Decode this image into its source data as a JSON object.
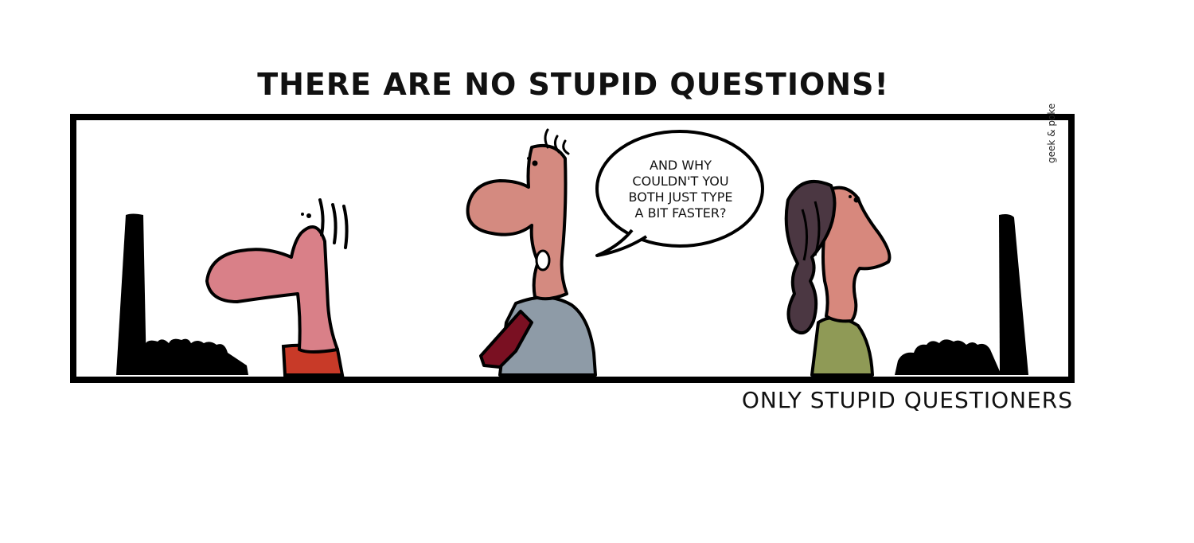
{
  "comic": {
    "title": "THERE ARE NO STUPID QUESTIONS!",
    "caption": "ONLY STUPID QUESTIONERS",
    "speech_bubble": {
      "lines": [
        "AND WHY",
        "COULDN'T YOU",
        "BOTH JUST TYPE",
        "A BIT FASTER?"
      ]
    },
    "signature": "geek & poke"
  },
  "colors": {
    "outline": "#000000",
    "skin_left": "#d98088",
    "skin_middle": "#d48a80",
    "skin_right": "#d7887d",
    "shirt_left": "#c83a28",
    "shirt_middle": "#8e9ba7",
    "tie": "#7a1022",
    "shirt_right": "#8f9a56",
    "hair_right": "#4b3742"
  }
}
